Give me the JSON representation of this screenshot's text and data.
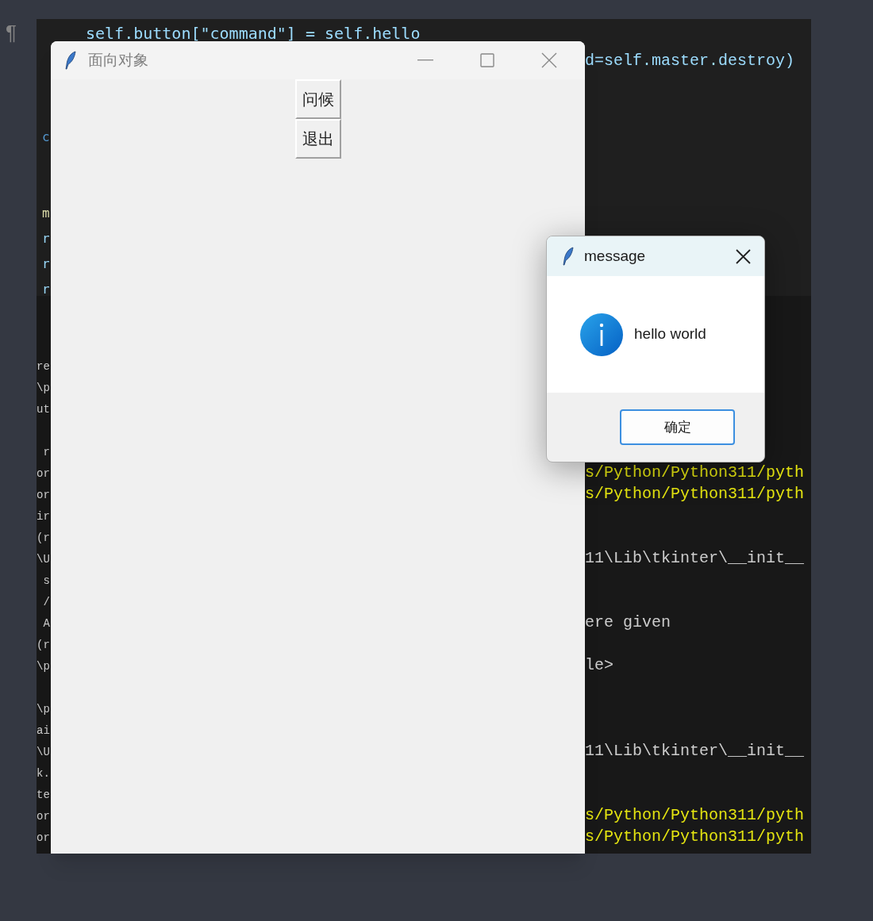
{
  "gutter": {
    "symbol": "¶"
  },
  "editor": {
    "lines": [
      {
        "kind": "indented",
        "right": "self.button[\"command\"] = self.hello"
      },
      {
        "kind": "split",
        "right": "d=self.master.destroy)"
      },
      {
        "kind": "blank"
      },
      {
        "kind": "blank"
      },
      {
        "kind": "split",
        "left": "c",
        "color": "#569cd6"
      },
      {
        "kind": "blank"
      },
      {
        "kind": "blank"
      },
      {
        "kind": "split",
        "left": "m",
        "color": "#dcdcaa"
      },
      {
        "kind": "split",
        "left": "r",
        "color": "#9cdcfe"
      },
      {
        "kind": "split",
        "left": "r",
        "color": "#9cdcfe"
      },
      {
        "kind": "split",
        "left": "r",
        "color": "#9cdcfe"
      }
    ]
  },
  "terminal": {
    "lines": [
      {
        "kind": "blank"
      },
      {
        "kind": "blank"
      },
      {
        "kind": "text",
        "left": "re"
      },
      {
        "kind": "text",
        "left": "\\p"
      },
      {
        "kind": "text",
        "left": "ut"
      },
      {
        "kind": "blank"
      },
      {
        "kind": "text",
        "left": " r"
      },
      {
        "kind": "path",
        "left": "or",
        "right": "s/Python/Python311/pyth"
      },
      {
        "kind": "path",
        "left": "or",
        "right": "s/Python/Python311/pyth"
      },
      {
        "kind": "text",
        "left": "ir"
      },
      {
        "kind": "text",
        "left": "(r"
      },
      {
        "kind": "text",
        "left": "\\U",
        "right": "11\\Lib\\tkinter\\__init__"
      },
      {
        "kind": "text",
        "left": " s"
      },
      {
        "kind": "text",
        "left": " /"
      },
      {
        "kind": "text",
        "left": " A",
        "right": "ere given"
      },
      {
        "kind": "text",
        "left": "(r"
      },
      {
        "kind": "text",
        "left": "\\p",
        "right": "le>"
      },
      {
        "kind": "blank"
      },
      {
        "kind": "text",
        "left": "\\p"
      },
      {
        "kind": "text",
        "left": "ai"
      },
      {
        "kind": "text",
        "left": "\\U",
        "right": "11\\Lib\\tkinter\\__init__"
      },
      {
        "kind": "text",
        "left": "k."
      },
      {
        "kind": "text",
        "left": "te"
      },
      {
        "kind": "path",
        "left": "or",
        "right": "s/Python/Python311/pyth"
      },
      {
        "kind": "path",
        "left": "or",
        "right": "s/Python/Python311/pyth"
      }
    ]
  },
  "main_window": {
    "title": "面向对象",
    "buttons": [
      "问候",
      "退出"
    ]
  },
  "dialog": {
    "title": "message",
    "message": "hello world",
    "button": "确定"
  }
}
